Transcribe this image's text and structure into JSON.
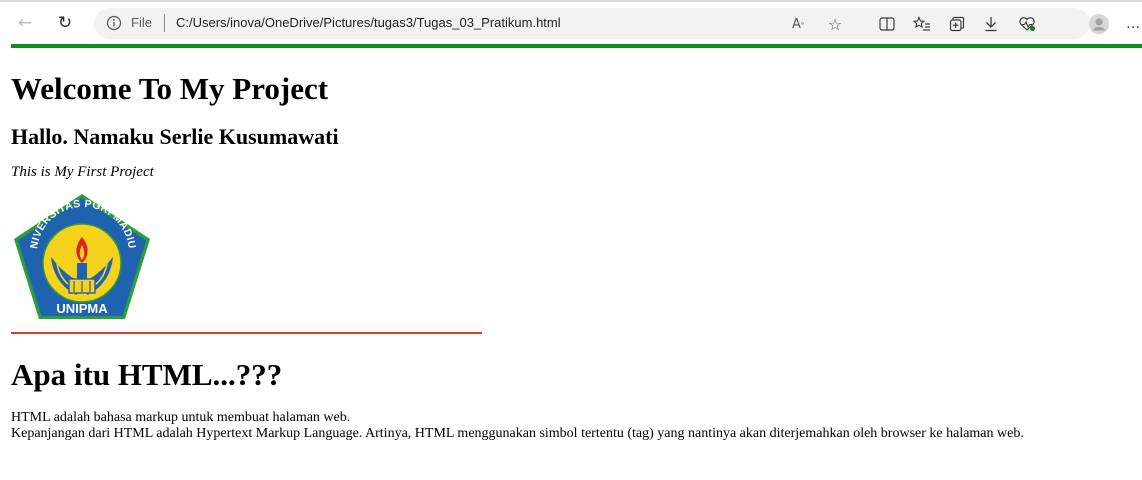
{
  "browser": {
    "address": {
      "scheme_label": "File",
      "url": "C:/Users/inova/OneDrive/Pictures/tugas3/Tugas_03_Pratikum.html"
    },
    "icons": [
      "back-icon",
      "refresh-icon",
      "info-icon",
      "read-aloud-icon",
      "favorite-star-icon",
      "split-screen-icon",
      "favorites-list-icon",
      "collections-icon",
      "downloads-icon",
      "browser-essentials-icon",
      "profile-avatar-icon",
      "more-icon"
    ],
    "accent_bar_color": "#0f8a1c"
  },
  "page": {
    "title": "Welcome To My Project",
    "greeting": "Hallo. Namaku Serlie Kusumawati",
    "tagline": "This is My First Project",
    "logo": {
      "arc_text": "UNIVERSITAS PGRI MADIUN",
      "banner_text": "UNIPMA",
      "colors": {
        "blue": "#1f63b0",
        "yellow": "#f6d21c",
        "red": "#d9232a",
        "green": "#2a9d3e"
      }
    },
    "divider_color": "#e53535",
    "section_title": "Apa itu HTML...???",
    "paragraph_lines": [
      "HTML adalah bahasa markup untuk membuat halaman web.",
      "Kepanjangan dari HTML adalah Hypertext Markup Language. Artinya, HTML menggunakan simbol tertentu (tag) yang nantinya akan diterjemahkan oleh browser ke halaman web."
    ]
  }
}
